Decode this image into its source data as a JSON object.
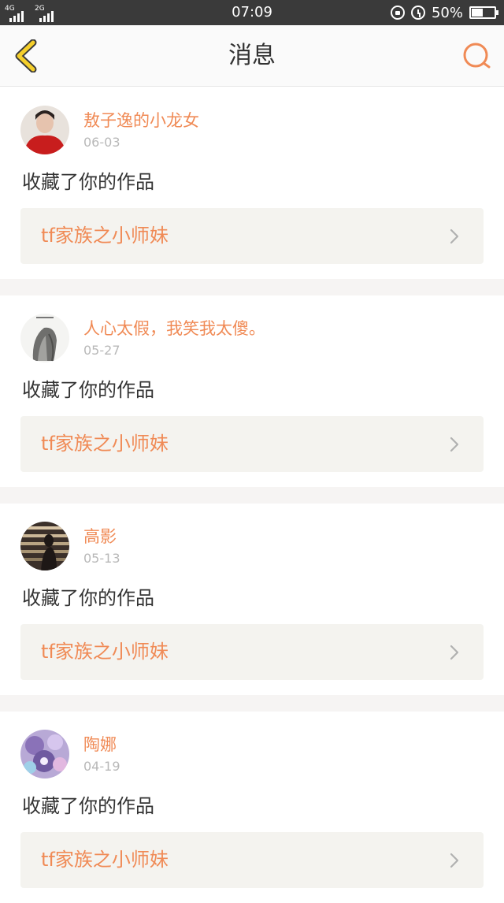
{
  "status_bar": {
    "network_1": "4G",
    "network_2": "2G",
    "time": "07:09",
    "battery_text": "50%",
    "battery_level": 0.5
  },
  "header": {
    "title": "消息",
    "back_icon": "chevron-left-icon",
    "search_icon": "search-icon"
  },
  "colors": {
    "accent": "#f08a55",
    "back_icon_yellow": "#f5cf2b",
    "card_bg": "#f4f3ef"
  },
  "messages": [
    {
      "username": "敖子逸的小龙女",
      "date": "06-03",
      "action": "收藏了你的作品",
      "work_title": "tf家族之小师妹"
    },
    {
      "username": "人心太假，我笑我太傻。",
      "date": "05-27",
      "action": "收藏了你的作品",
      "work_title": "tf家族之小师妹"
    },
    {
      "username": "高影",
      "date": "05-13",
      "action": "收藏了你的作品",
      "work_title": "tf家族之小师妹"
    },
    {
      "username": "陶娜",
      "date": "04-19",
      "action": "收藏了你的作品",
      "work_title": "tf家族之小师妹"
    }
  ]
}
